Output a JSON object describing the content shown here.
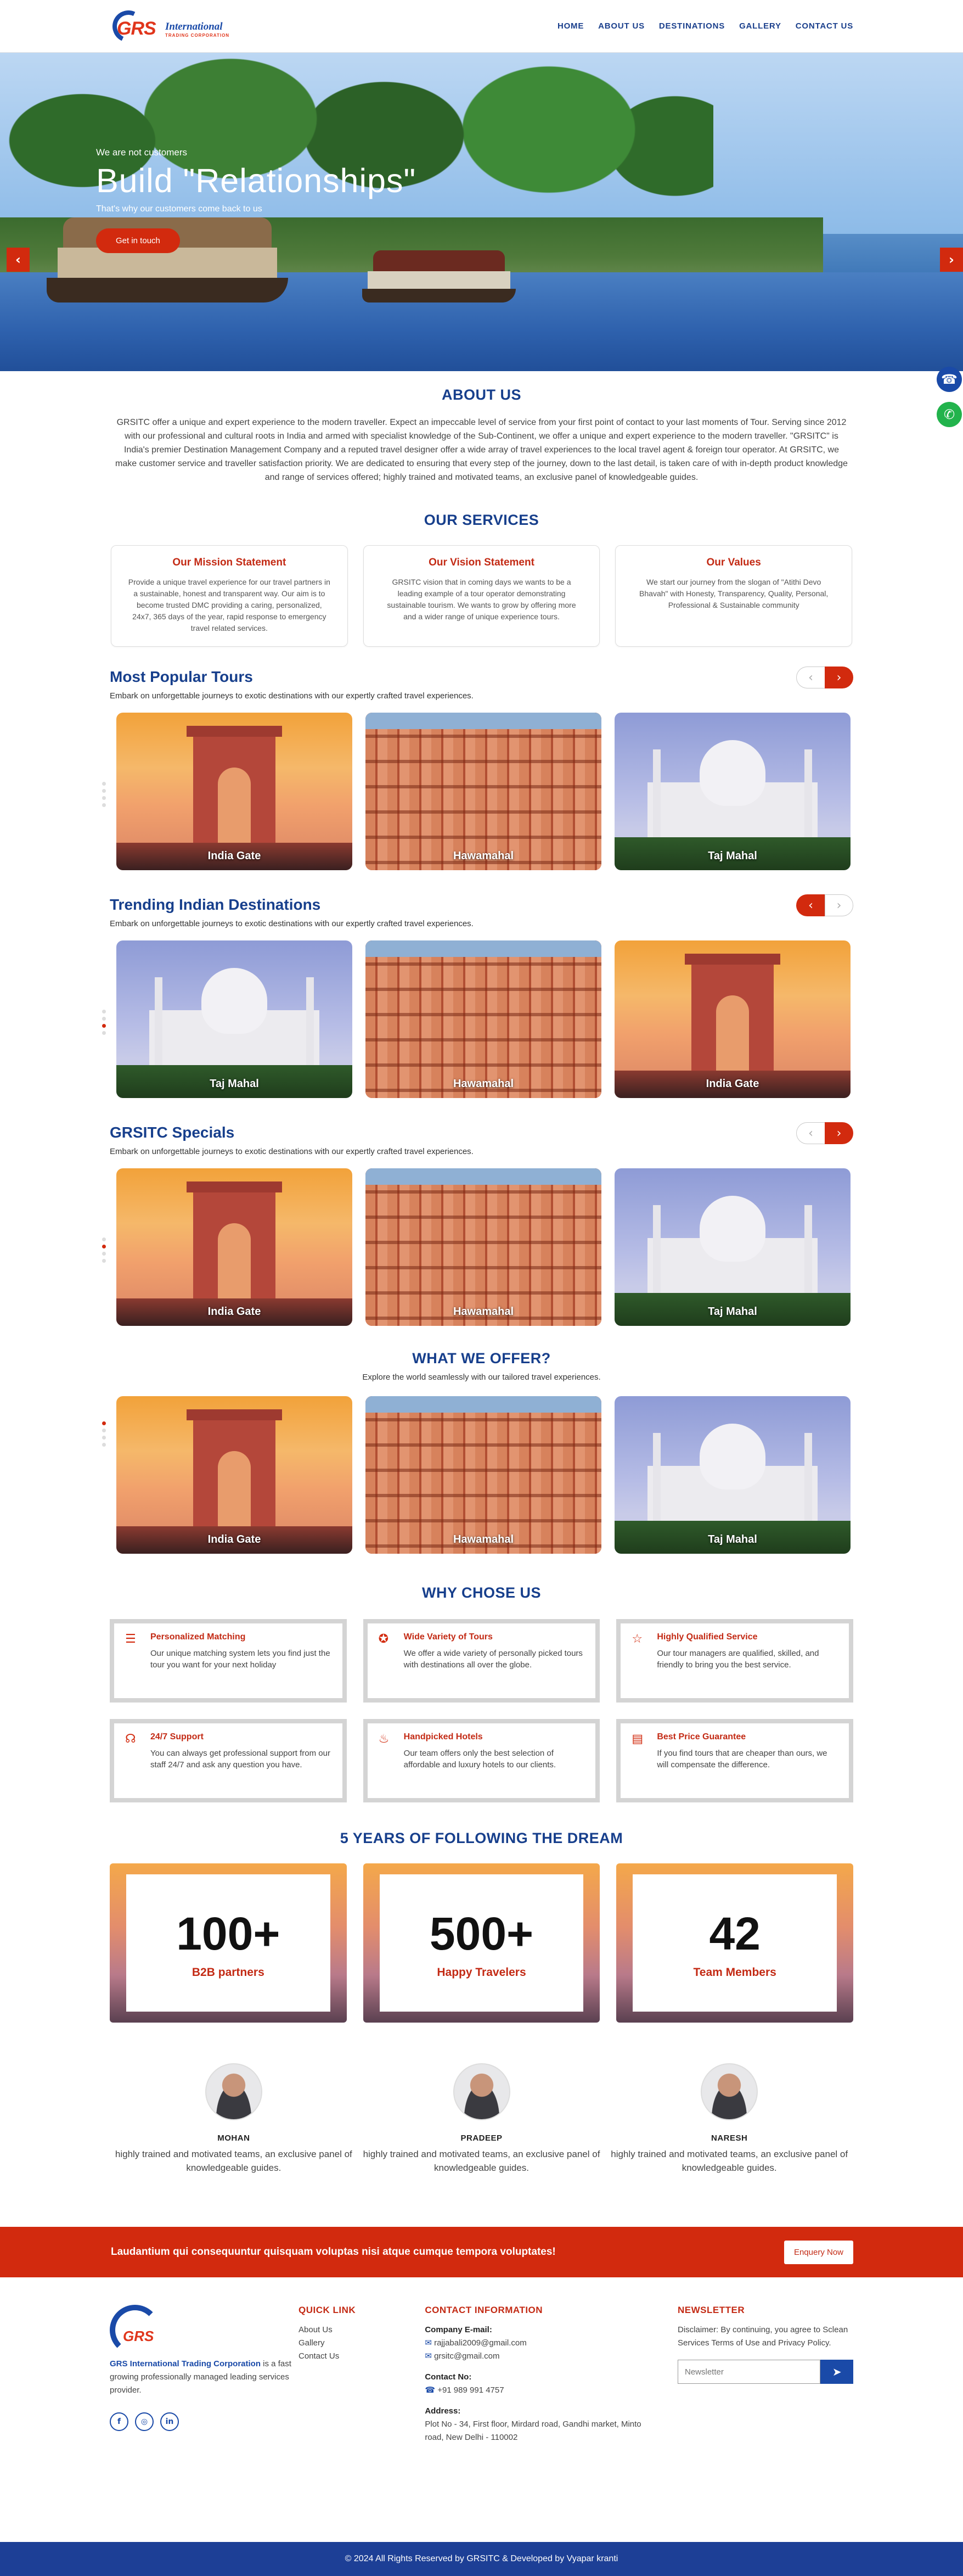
{
  "brand": {
    "name": "GRS",
    "tagline": "International",
    "subtag": "TRADING CORPORATION"
  },
  "nav": {
    "items": [
      "HOME",
      "ABOUT US",
      "DESTINATIONS",
      "GALLERY",
      "CONTACT US"
    ]
  },
  "hero": {
    "pre": "We are not customers",
    "title": "Build \"Relationships\"",
    "sub": "That's why our customers come back to us",
    "cta": "Get in touch",
    "prev": "‹",
    "next": "›"
  },
  "float": {
    "phone": "☎",
    "whatsapp": "✆"
  },
  "about": {
    "title": "ABOUT US",
    "text": "GRSITC offer a unique and expert experience to the modern traveller. Expect an impeccable level of service from your first point of contact to your last moments of Tour. Serving since 2012 with our professional and cultural roots in India and armed with specialist knowledge of the Sub-Continent, we offer a unique and expert experience to the modern traveller. \"GRSITC\" is India's premier Destination Management Company and a reputed travel designer offer a wide array of travel experiences to the local travel agent & foreign tour operator. At GRSITC, we make customer service and traveller satisfaction priority. We are dedicated to ensuring that every step of the journey, down to the last detail, is taken care of with in-depth product knowledge and range of services offered; highly trained and motivated teams, an exclusive panel of knowledgeable guides."
  },
  "services": {
    "title": "OUR SERVICES",
    "cards": [
      {
        "title": "Our Mission Statement",
        "text": "Provide a unique travel experience for our travel partners in a sustainable, honest and transparent way. Our aim is to become trusted DMC providing a caring, personalized, 24x7, 365 days of the year, rapid response to emergency travel related services."
      },
      {
        "title": "Our Vision Statement",
        "text": "GRSITC vision that in coming days we wants to be a leading example of a tour operator demonstrating sustainable tourism. We wants to grow by offering more and a wider range of unique experience tours."
      },
      {
        "title": "Our Values",
        "text": "We start our journey from the slogan of \"Atithi Devo Bhavah\" with Honesty, Transparency, Quality, Personal, Professional & Sustainable community"
      }
    ]
  },
  "sliders": [
    {
      "title": "Most Popular Tours",
      "sub": "Embark on unforgettable journeys to exotic destinations with our expertly crafted travel experiences.",
      "prev": "‹",
      "next": "›",
      "tiles": [
        "India Gate",
        "Hawamahal",
        "Taj Mahal"
      ]
    },
    {
      "title": "Trending Indian Destinations",
      "sub": "Embark on unforgettable journeys to exotic destinations with our expertly crafted travel experiences.",
      "prev": "‹",
      "next": "›",
      "tiles": [
        "Taj Mahal",
        "Hawamahal",
        "India Gate"
      ]
    },
    {
      "title": "GRSITC Specials",
      "sub": "Embark on unforgettable journeys to exotic destinations with our expertly crafted travel experiences.",
      "prev": "‹",
      "next": "›",
      "tiles": [
        "India Gate",
        "Hawamahal",
        "Taj Mahal"
      ]
    }
  ],
  "offer": {
    "title": "WHAT WE OFFER?",
    "sub": "Explore the world seamlessly with our tailored travel experiences.",
    "tiles": [
      "India Gate",
      "Hawamahal",
      "Taj Mahal"
    ]
  },
  "why": {
    "title": "WHY CHOSE US",
    "items": [
      {
        "icon": "☰",
        "title": "Personalized Matching",
        "text": "Our unique matching system lets you find just the tour you want for your next holiday"
      },
      {
        "icon": "✪",
        "title": "Wide Variety of Tours",
        "text": "We offer a wide variety of personally picked tours with destinations all over the globe."
      },
      {
        "icon": "☆",
        "title": "Highly Qualified Service",
        "text": "Our tour managers are qualified, skilled, and friendly to bring you the best service."
      },
      {
        "icon": "☊",
        "title": "24/7 Support",
        "text": "You can always get professional support from our staff 24/7 and ask any question you have."
      },
      {
        "icon": "♨",
        "title": "Handpicked Hotels",
        "text": "Our team offers only the best selection of affordable and luxury hotels to our clients."
      },
      {
        "icon": "▤",
        "title": "Best Price Guarantee",
        "text": "If you find tours that are cheaper than ours, we will compensate the difference."
      }
    ]
  },
  "stats": {
    "title": "5 YEARS OF FOLLOWING THE DREAM",
    "items": [
      {
        "num": "100+",
        "label": "B2B partners"
      },
      {
        "num": "500+",
        "label": "Happy Travelers"
      },
      {
        "num": "42",
        "label": "Team Members"
      }
    ]
  },
  "team": [
    {
      "name": "MOHAN",
      "text": "highly trained and motivated teams, an exclusive panel of knowledgeable guides."
    },
    {
      "name": "PRADEEP",
      "text": "highly trained and motivated teams, an exclusive panel of knowledgeable guides."
    },
    {
      "name": "NARESH",
      "text": "highly trained and motivated teams, an exclusive panel of knowledgeable guides."
    }
  ],
  "cta": {
    "text": "Laudantium qui consequuntur quisquam voluptas nisi atque cumque tempora voluptates!",
    "button": "Enquery Now"
  },
  "footer": {
    "company": "GRS International Trading Corporation",
    "about": " is a fast growing professionally managed leading services provider.",
    "quick_title": "QUICK LINK",
    "quick": [
      "About Us",
      "Gallery",
      "Contact Us"
    ],
    "contact_title": "CONTACT INFORMATION",
    "email_label": "Company E-mail:",
    "emails": [
      "rajjabali2009@gmail.com",
      "grsitc@gmail.com"
    ],
    "phone_label": "Contact No:",
    "phone": "+91 989 991 4757",
    "address_label": "Address:",
    "address": "Plot No - 34, First floor, Mirdard road, Gandhi market, Minto road, New Delhi - 110002",
    "news_title": "NEWSLETTER",
    "news_text": "Disclaimer: By continuing, you agree to Sclean Services Terms of Use and Privacy Policy.",
    "news_placeholder": "Newsletter",
    "send": "➤",
    "social": [
      "f",
      "◎",
      "in"
    ],
    "copyright": "© 2024 All Rights Reserved by GRSITC & Developed by Vyapar kranti"
  }
}
